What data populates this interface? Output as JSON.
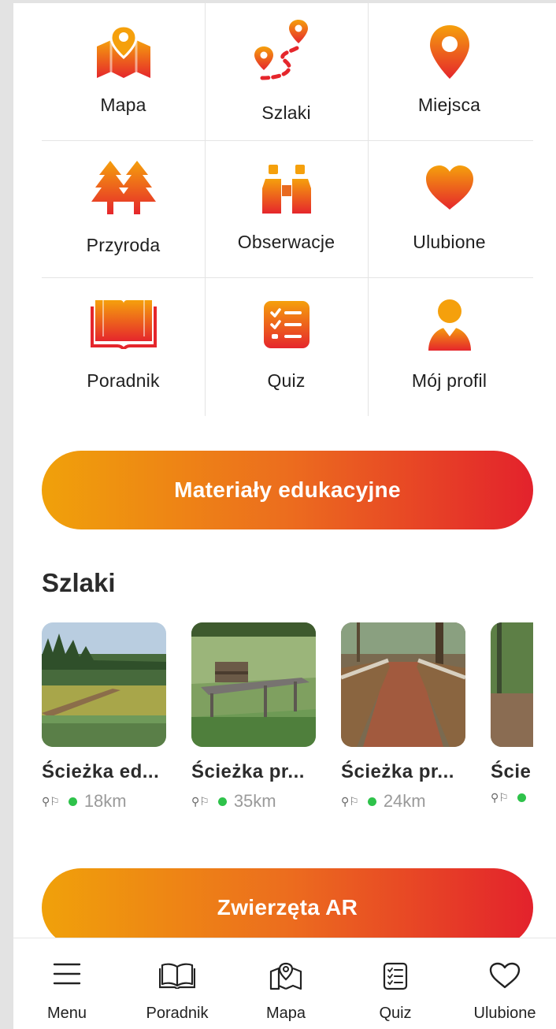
{
  "tiles": [
    {
      "label": "Mapa",
      "icon": "map-pin-icon"
    },
    {
      "label": "Szlaki",
      "icon": "route-icon"
    },
    {
      "label": "Miejsca",
      "icon": "location-pin-icon"
    },
    {
      "label": "Przyroda",
      "icon": "trees-icon"
    },
    {
      "label": "Obserwacje",
      "icon": "binoculars-icon"
    },
    {
      "label": "Ulubione",
      "icon": "heart-icon"
    },
    {
      "label": "Poradnik",
      "icon": "book-icon"
    },
    {
      "label": "Quiz",
      "icon": "checklist-icon"
    },
    {
      "label": "Mój profil",
      "icon": "user-icon"
    }
  ],
  "buttons": {
    "materials": "Materiały edukacyjne",
    "ar": "Zwierzęta AR"
  },
  "section": {
    "title": "Szlaki"
  },
  "trails": [
    {
      "name": "Ścieżka ed...",
      "distance": "18km"
    },
    {
      "name": "Ścieżka pr...",
      "distance": "35km"
    },
    {
      "name": "Ścieżka pr...",
      "distance": "24km"
    },
    {
      "name": "Ście",
      "distance": ""
    }
  ],
  "bottom_nav": [
    {
      "label": "Menu",
      "icon": "hamburger-icon"
    },
    {
      "label": "Poradnik",
      "icon": "book-outline-icon"
    },
    {
      "label": "Mapa",
      "icon": "map-outline-icon"
    },
    {
      "label": "Quiz",
      "icon": "checklist-outline-icon"
    },
    {
      "label": "Ulubione",
      "icon": "heart-outline-icon"
    }
  ],
  "colors": {
    "accent_start": "#f0a10a",
    "accent_end": "#e3222c",
    "status_dot": "#2ec24a"
  }
}
